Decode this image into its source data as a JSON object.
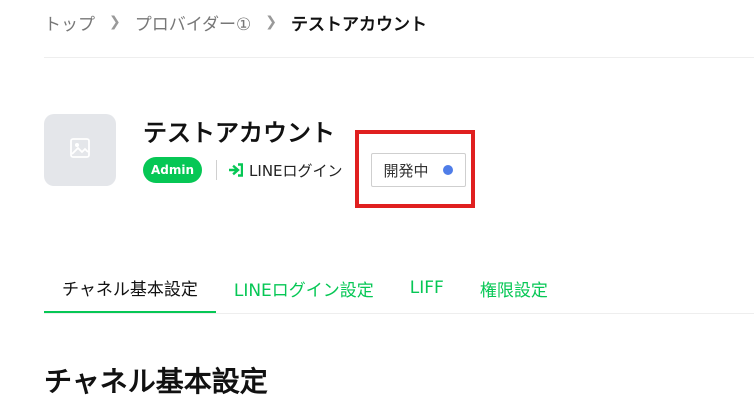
{
  "breadcrumb": {
    "items": [
      "トップ",
      "プロバイダー①"
    ],
    "current": "テストアカウント"
  },
  "channel": {
    "icon": "image-placeholder-icon",
    "name": "テストアカウント",
    "role_badge": "Admin",
    "login_icon": "line-login-arrow-icon",
    "login_type": "LINEログイン",
    "status": "開発中",
    "status_dot_color": "#4f7de8"
  },
  "tabs": [
    {
      "label": "チャネル基本設定",
      "active": true
    },
    {
      "label": "LINEログイン設定",
      "active": false
    },
    {
      "label": "LIFF",
      "active": false
    },
    {
      "label": "権限設定",
      "active": false
    }
  ],
  "section": {
    "title": "チャネル基本設定"
  },
  "colors": {
    "accent": "#06c755",
    "highlight": "#e02020"
  }
}
